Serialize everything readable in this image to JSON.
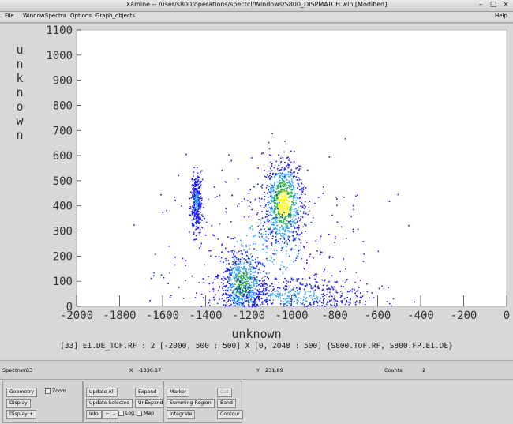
{
  "window": {
    "title": "Xamine -- /user/s800/operations/spectcl/Windows/S800_DISPMATCH.win [Modified]",
    "buttons": [
      "–",
      "□",
      "×"
    ]
  },
  "menubar": {
    "file": "File",
    "window": "Window",
    "spectra": "Spectra",
    "options": "Options",
    "graph_objects": "Graph_objects",
    "help": "Help"
  },
  "colors": {
    "low": "#1a1aff",
    "mid_low": "#2aa0ff",
    "mid": "#29b34a",
    "high": "#ffff00",
    "plot_bg": "#ffffff"
  },
  "chart_data": {
    "type": "heatmap",
    "xlabel": "unknown",
    "ylabel": "unknown",
    "xlim": [
      -2000,
      0
    ],
    "ylim": [
      0,
      1100
    ],
    "x_ticks": [
      "-2000",
      "-1800",
      "-1600",
      "-1400",
      "-1200",
      "-1000",
      "-800",
      "-600",
      "-400",
      "-200",
      "0"
    ],
    "y_ticks": [
      "0",
      "100",
      "200",
      "300",
      "400",
      "500",
      "600",
      "700",
      "800",
      "900",
      "1000",
      "1100"
    ],
    "clusters": [
      {
        "x": -1040,
        "y": 410,
        "sx": 45,
        "sy": 85,
        "weight": 0.9,
        "level": "high"
      },
      {
        "x": -1230,
        "y": 90,
        "sx": 50,
        "sy": 65,
        "weight": 0.7,
        "level": "mid"
      },
      {
        "x": -1120,
        "y": 230,
        "sx": 230,
        "sy": 170,
        "weight": 0.5,
        "level": "mid_low"
      },
      {
        "x": -1000,
        "y": 40,
        "sx": 190,
        "sy": 40,
        "weight": 0.6,
        "level": "mid_low"
      },
      {
        "x": -1445,
        "y": 420,
        "sx": 12,
        "sy": 55,
        "weight": 0.4,
        "level": "mid_low"
      }
    ],
    "description": "[33] E1.DE_TOF.RF : 2 [-2000, 500 : 500] X [0, 2048 : 500] {S800.TOF.RF, S800.FP.E1.DE}"
  },
  "status": {
    "spectrum_label": "Spectrum",
    "spectrum_value": "33",
    "x_label": "X",
    "x_value": "-1336.17",
    "y_label": "Y",
    "y_value": "231.89",
    "counts_label": "Counts",
    "counts_value": "2"
  },
  "controls": {
    "geometry": "Geometry",
    "zoom": "Zoom",
    "display": "Display",
    "display_plus": "Display +",
    "update_all": "Update All",
    "expand": "Expand",
    "update_selected": "Update Selected",
    "unexpand": "UnExpand",
    "info": "Info",
    "plus": "+",
    "minus": "–",
    "log": "Log",
    "map": "Map",
    "marker": "Marker",
    "cut": "Cut",
    "summing_region": "Summing Region",
    "band": "Band",
    "integrate": "Integrate",
    "contour": "Contour"
  }
}
